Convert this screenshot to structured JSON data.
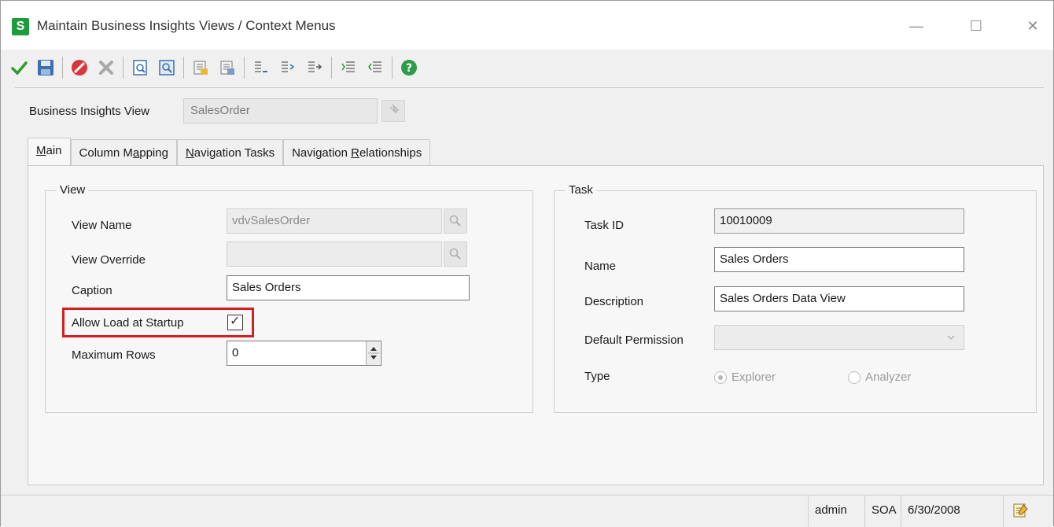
{
  "window": {
    "title": "Maintain Business Insights Views / Context Menus",
    "app_icon_letter": "S",
    "minimize_glyph": "—",
    "maximize_glyph": "☐",
    "close_glyph": "✕"
  },
  "toolbar": {
    "buttons": [
      {
        "icon": "accept-check-icon"
      },
      {
        "icon": "save-icon"
      },
      {
        "icon": "cancel-icon"
      },
      {
        "icon": "delete-icon"
      },
      {
        "icon": "preview-icon"
      },
      {
        "icon": "print-preview-icon"
      },
      {
        "icon": "copy-from-icon"
      },
      {
        "icon": "copy-to-icon"
      },
      {
        "icon": "outdent-icon"
      },
      {
        "icon": "indent-icon"
      },
      {
        "icon": "move-right-icon"
      },
      {
        "icon": "list-icon"
      },
      {
        "icon": "list-alt-icon"
      },
      {
        "icon": "help-icon"
      }
    ]
  },
  "header": {
    "biv_label": "Business Insights View",
    "biv_value": "SalesOrder"
  },
  "tabs": [
    {
      "label_pre": "",
      "label_u": "M",
      "label_post": "ain",
      "active": true
    },
    {
      "label_pre": "Column M",
      "label_u": "a",
      "label_post": "pping",
      "active": false
    },
    {
      "label_pre": "",
      "label_u": "N",
      "label_post": "avigation Tasks",
      "active": false
    },
    {
      "label_pre": "Navigation ",
      "label_u": "R",
      "label_post": "elationships",
      "active": false
    }
  ],
  "view_group": {
    "title": "View",
    "view_name_label": "View Name",
    "view_name_value": "vdvSalesOrder",
    "view_override_label": "View Override",
    "view_override_value": "",
    "caption_label": "Caption",
    "caption_value": "Sales Orders",
    "allow_load_label": "Allow Load at Startup",
    "allow_load_checked": true,
    "allow_load_checkmark": "✓",
    "max_rows_label": "Maximum Rows",
    "max_rows_value": "0"
  },
  "task_group": {
    "title": "Task",
    "task_id_label": "Task ID",
    "task_id_value": "10010009",
    "name_label": "Name",
    "name_value": "Sales Orders",
    "description_label": "Description",
    "description_value": "Sales Orders Data View",
    "default_permission_label": "Default Permission",
    "default_permission_value": "",
    "type_label": "Type",
    "type_options": [
      "Explorer",
      "Analyzer"
    ],
    "type_selected": "Explorer"
  },
  "statusbar": {
    "user": "admin",
    "company": "SOA",
    "date": "6/30/2008"
  },
  "colors": {
    "highlight": "#d02020",
    "brand_green": "#1e9b3a"
  }
}
